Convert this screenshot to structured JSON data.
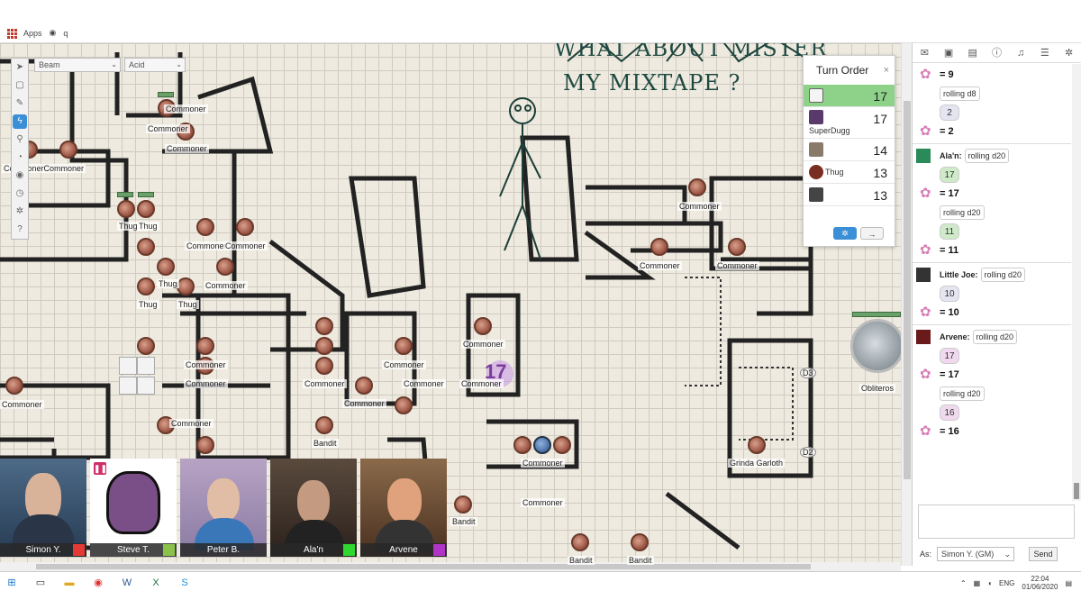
{
  "browser": {
    "apps_label": "Apps",
    "bookmark_label": "q"
  },
  "toolbar": {
    "tools": [
      "select-tool",
      "map-tool",
      "draw-tool",
      "ruler-tool",
      "zoom-tool",
      "dice-tool",
      "fog-tool",
      "turn-tool",
      "settings-tool",
      "help-tool"
    ],
    "beam_select": "Beam",
    "acid_select": "Acid"
  },
  "map": {
    "labels": [
      "Commoner",
      "Commoner",
      "Commoner",
      "CommonerCommoner",
      "Thug",
      "Thug",
      "Thug",
      "Thug",
      "Commoner",
      "Commoner",
      "Thug",
      "Thug",
      "Commoner",
      "Commoner",
      "Commoner",
      "Commoner",
      "Commoner",
      "Commoner",
      "Commoner",
      "Commoner",
      "Commoner",
      "Commoner",
      "Commoner",
      "Commoner",
      "Commoner",
      "Commoner",
      "Commoner",
      "Bandit",
      "Bandit",
      "Bandit",
      "Bandit",
      "Grinda Garloth",
      "Obliteros",
      "Commoner",
      "Commoner",
      "Commoner",
      "Commoner"
    ],
    "scrawl_line1": "WHAT ABOUT MISTER",
    "scrawl_line2": "MY MIXTAPE ?",
    "turn_marker": "17",
    "door_labels": [
      "D3",
      "D2"
    ]
  },
  "turn_order": {
    "title": "Turn Order",
    "close": "×",
    "entries": [
      {
        "name": "",
        "value": "17",
        "active": true
      },
      {
        "name": "SuperDugg",
        "value": "17",
        "active": false
      },
      {
        "name": "",
        "value": "14",
        "active": false
      },
      {
        "name": "Thug",
        "value": "13",
        "active": false
      },
      {
        "name": "",
        "value": "13",
        "active": false
      }
    ],
    "next_label": "→"
  },
  "videos": [
    {
      "name": "Simon Y.",
      "color": "#e53935"
    },
    {
      "name": "Steve T.",
      "color": "#8bc34a"
    },
    {
      "name": "Peter B.",
      "color": ""
    },
    {
      "name": "Ala'n",
      "color": "#2ed82e"
    },
    {
      "name": "Arvene",
      "color": "#b034c8"
    }
  ],
  "chat": {
    "messages": [
      {
        "kind": "result",
        "text": "= 9"
      },
      {
        "kind": "roll",
        "who": "",
        "text": "rolling d8",
        "die": "2",
        "result": "= 2",
        "tone": ""
      },
      {
        "kind": "roll",
        "who": "Ala'n:",
        "text": "rolling d20",
        "die": "17",
        "result": "= 17",
        "tone": "green"
      },
      {
        "kind": "roll",
        "who": "",
        "text": "rolling d20",
        "die": "11",
        "result": "= 11",
        "tone": "green"
      },
      {
        "kind": "roll",
        "who": "Little Joe:",
        "text": "rolling d20",
        "die": "10",
        "result": "= 10",
        "tone": ""
      },
      {
        "kind": "roll",
        "who": "Arvene:",
        "text": "rolling d20",
        "die": "17",
        "result": "= 17",
        "tone": "pink"
      },
      {
        "kind": "roll",
        "who": "",
        "text": "rolling d20",
        "die": "16",
        "result": "= 16",
        "tone": "pink"
      }
    ],
    "as_label": "As:",
    "as_value": "Simon Y. (GM)",
    "send_label": "Send"
  },
  "taskbar": {
    "lang": "ENG",
    "time": "22:04",
    "date": "01/06/2020"
  }
}
